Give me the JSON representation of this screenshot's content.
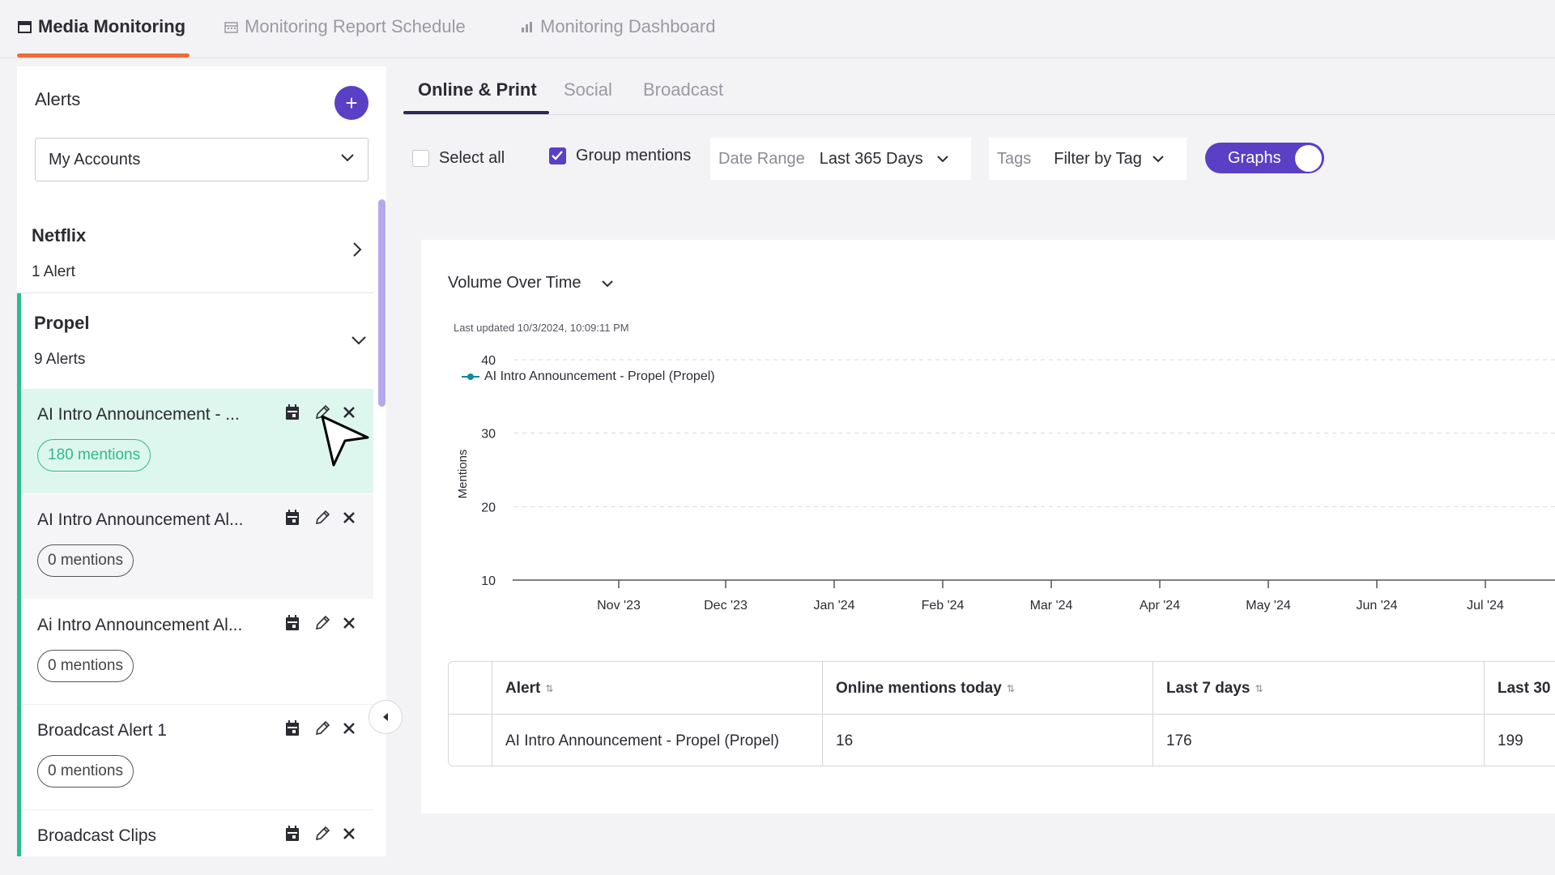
{
  "top_tabs": [
    {
      "label": "Media Monitoring",
      "icon": "window-icon",
      "active": true
    },
    {
      "label": "Monitoring Report Schedule",
      "icon": "calendar-icon",
      "active": false
    },
    {
      "label": "Monitoring Dashboard",
      "icon": "bar-chart-icon",
      "active": false
    }
  ],
  "sidebar": {
    "title": "Alerts",
    "add_label": "+",
    "account_select": "My Accounts",
    "groups": [
      {
        "name": "Netflix",
        "count": "1 Alert",
        "expanded": false
      },
      {
        "name": "Propel",
        "count": "9 Alerts",
        "expanded": true
      }
    ],
    "alerts": [
      {
        "name": "AI Intro Announcement - ...",
        "mentions": "180 mentions",
        "selected": true
      },
      {
        "name": "AI Intro Announcement Al...",
        "mentions": "0 mentions",
        "selected": false
      },
      {
        "name": "Ai Intro Announcement Al...",
        "mentions": "0 mentions",
        "selected": false
      },
      {
        "name": "Broadcast Alert 1",
        "mentions": "0 mentions",
        "selected": false
      },
      {
        "name": "Broadcast Clips",
        "mentions": "",
        "selected": false
      }
    ]
  },
  "sub_tabs": [
    {
      "label": "Online & Print",
      "active": true
    },
    {
      "label": "Social",
      "active": false
    },
    {
      "label": "Broadcast",
      "active": false
    }
  ],
  "filters": {
    "select_all": "Select all",
    "group_mentions": "Group mentions",
    "group_mentions_checked": true,
    "date_range_label": "Date Range",
    "date_range_value": "Last 365 Days",
    "tags_label": "Tags",
    "tags_value": "Filter by Tag",
    "graphs_toggle": "Graphs",
    "graphs_on": true
  },
  "chart": {
    "metric": "Volume Over Time",
    "updated": "Last updated 10/3/2024, 10:09:11 PM"
  },
  "chart_data": {
    "type": "line",
    "title": "Volume Over Time",
    "ylabel": "Mentions",
    "xlabel": "",
    "ylim": [
      10,
      40
    ],
    "yticks": [
      40,
      30,
      20,
      10
    ],
    "categories": [
      "Nov '23",
      "Dec '23",
      "Jan '24",
      "Feb '24",
      "Mar '24",
      "Apr '24",
      "May '24",
      "Jun '24",
      "Jul '24"
    ],
    "series": [
      {
        "name": "AI Intro Announcement - Propel (Propel)",
        "color": "#13899a",
        "values": []
      }
    ],
    "grid": true,
    "legend": "top-left"
  },
  "table": {
    "headers": [
      "Alert",
      "Online mentions today",
      "Last 7 days",
      "Last 30"
    ],
    "rows": [
      [
        "AI Intro Announcement - Propel (Propel)",
        "16",
        "176",
        "199"
      ]
    ]
  },
  "colors": {
    "accent": "#5b3fc4",
    "tab_underline": "#ef6b3a",
    "selected_alert": "#def7ee",
    "mentions_green": "#2dbb8f",
    "series": "#13899a"
  }
}
